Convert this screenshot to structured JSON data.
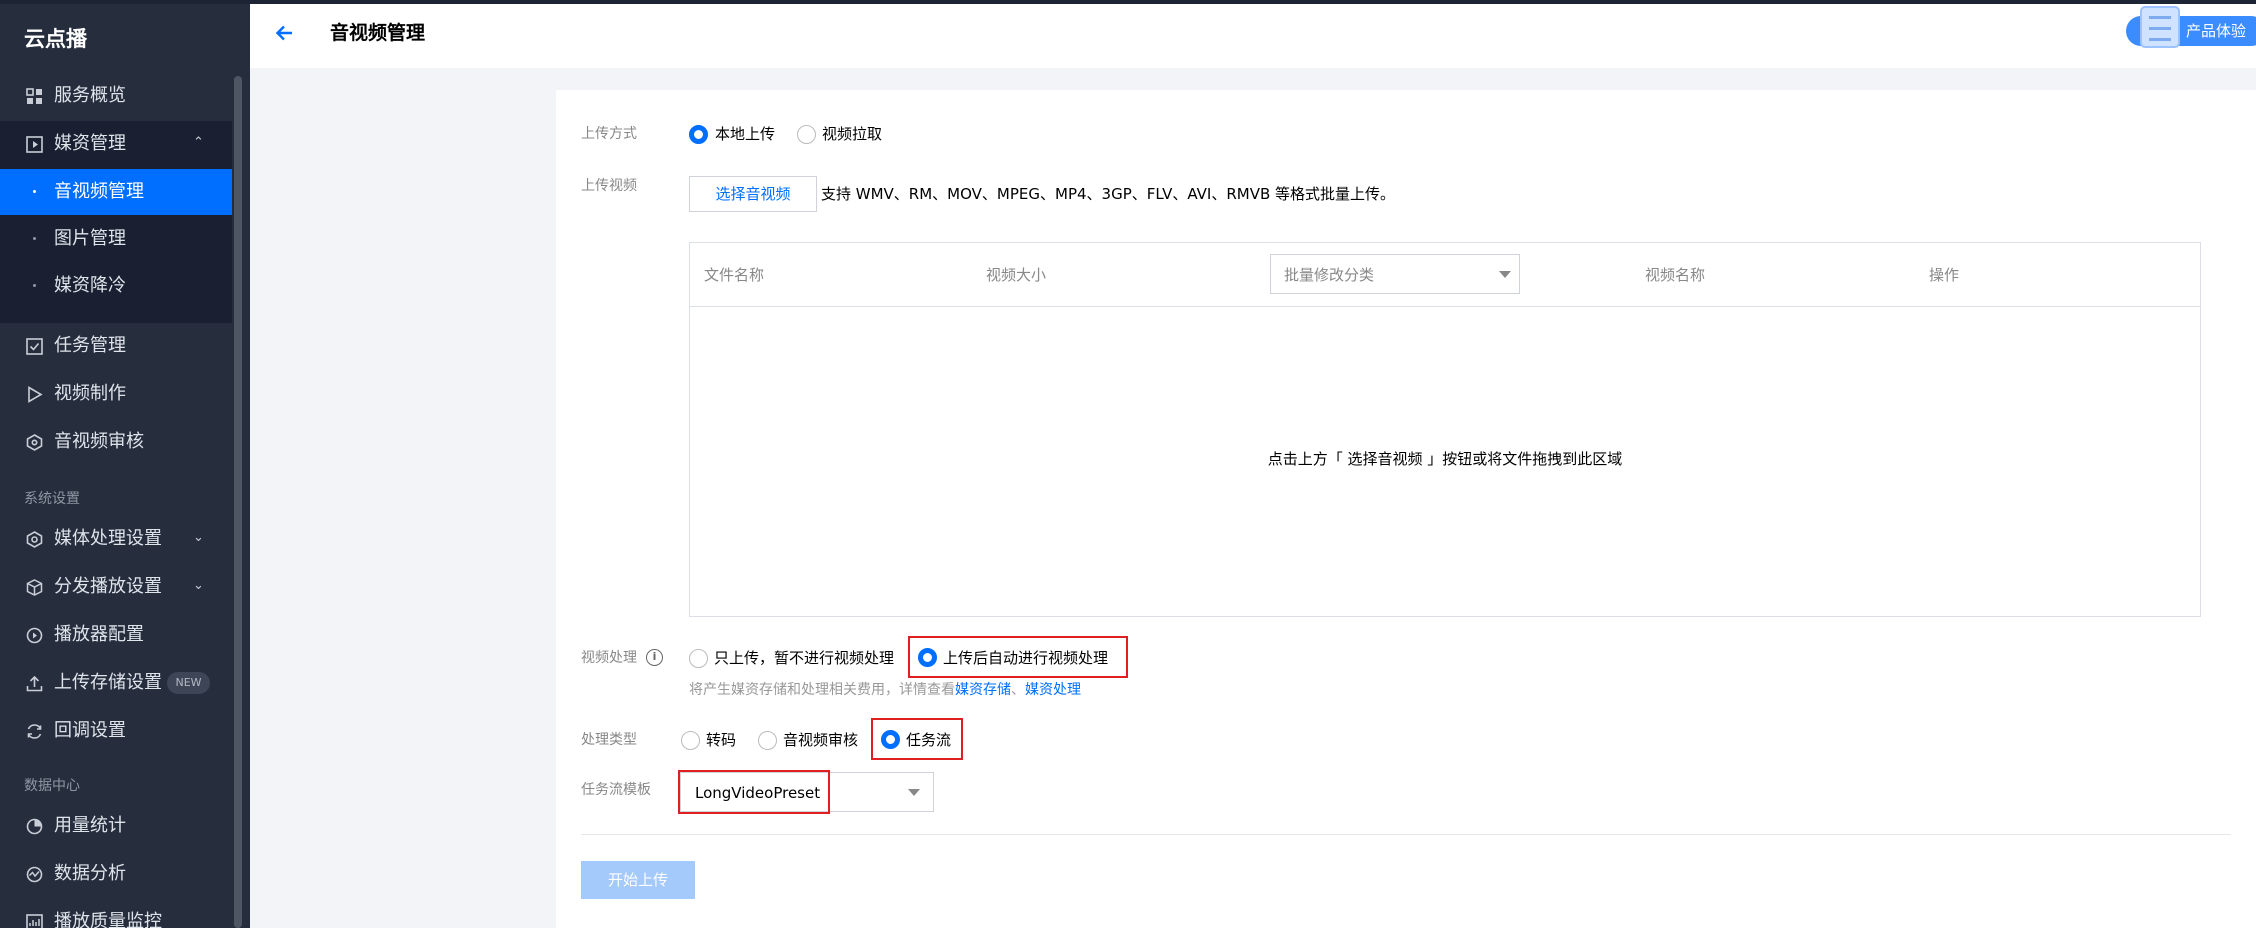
{
  "sidebar": {
    "logo": "云点播",
    "items": [
      {
        "label": "服务概览"
      },
      {
        "label": "媒资管理"
      },
      {
        "label": "任务管理"
      },
      {
        "label": "视频制作"
      },
      {
        "label": "音视频审核"
      },
      {
        "label": "媒体处理设置"
      },
      {
        "label": "分发播放设置"
      },
      {
        "label": "播放器配置"
      },
      {
        "label": "上传存储设置"
      },
      {
        "label": "回调设置"
      },
      {
        "label": "用量统计"
      },
      {
        "label": "数据分析"
      },
      {
        "label": "播放质量监控"
      }
    ],
    "submenu": [
      "音视频管理",
      "图片管理",
      "媒资降冷"
    ],
    "sections": [
      "系统设置",
      "数据中心"
    ],
    "new_badge": "NEW"
  },
  "header": {
    "title": "音视频管理",
    "experience_label": "产品体验"
  },
  "form": {
    "upload_method_label": "上传方式",
    "upload_methods": [
      "本地上传",
      "视频拉取"
    ],
    "upload_video_label": "上传视频",
    "select_button": "选择音视频",
    "support_hint": "支持 WMV、RM、MOV、MPEG、MP4、3GP、FLV、AVI、RMVB 等格式批量上传。",
    "table_headers": [
      "文件名称",
      "视频大小",
      "视频名称",
      "操作"
    ],
    "batch_category_placeholder": "批量修改分类",
    "empty_message": "点击上方「 选择音视频 」按钮或将文件拖拽到此区域",
    "video_processing_label": "视频处理",
    "processing_options": [
      "只上传，暂不进行视频处理",
      "上传后自动进行视频处理"
    ],
    "fee_note": "将产生媒资存储和处理相关费用，详情查看",
    "fee_link_1": "媒资存储",
    "fee_sep": "、",
    "fee_link_2": "媒资处理",
    "processing_type_label": "处理类型",
    "processing_types": [
      "转码",
      "音视频审核",
      "任务流"
    ],
    "workflow_template_label": "任务流模板",
    "workflow_template_value": "LongVideoPreset",
    "start_button": "开始上传"
  }
}
